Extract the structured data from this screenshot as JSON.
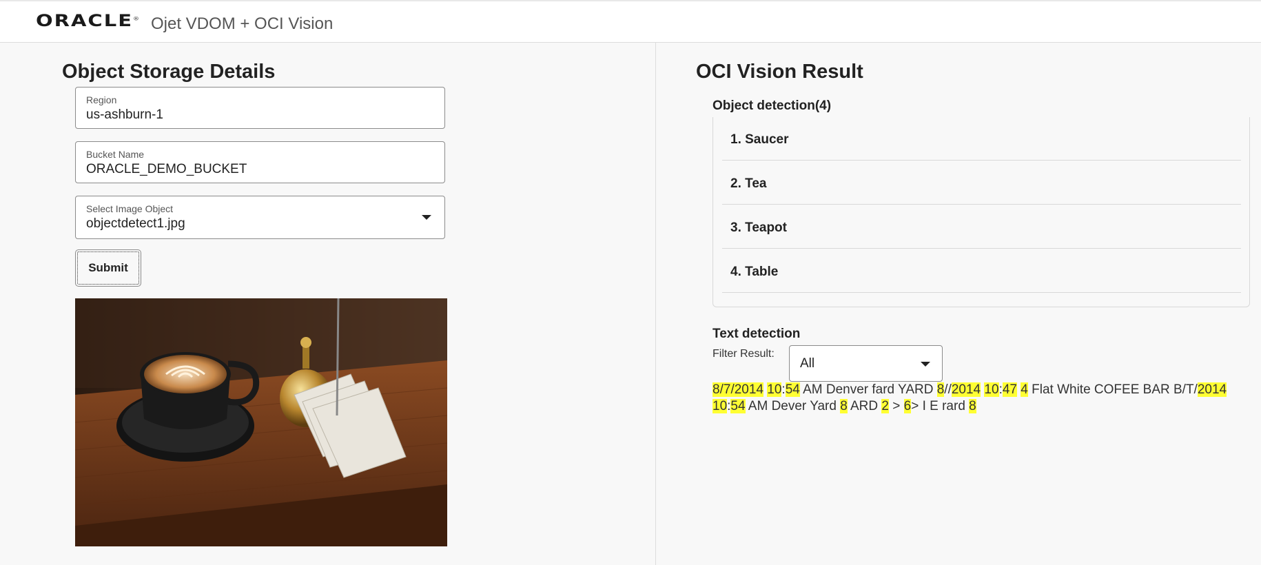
{
  "header": {
    "logo_text": "ORACLE",
    "logo_mark": "®",
    "app_title": "Ojet VDOM + OCI Vision"
  },
  "left": {
    "title": "Object Storage Details",
    "region": {
      "label": "Region",
      "value": "us-ashburn-1"
    },
    "bucket": {
      "label": "Bucket Name",
      "value": "ORACLE_DEMO_BUCKET"
    },
    "image_object": {
      "label": "Select Image Object",
      "value": "objectdetect1.jpg"
    },
    "submit_label": "Submit",
    "photo_alt": "objectdetect1.jpg"
  },
  "right": {
    "title": "OCI Vision Result",
    "object_detection": {
      "heading": "Object detection(4)",
      "items": [
        "1. Saucer",
        "2. Tea",
        "3. Teapot",
        "4. Table"
      ]
    },
    "text_detection": {
      "heading": "Text detection",
      "filter_label": "Filter Result:",
      "filter_value": "All",
      "tokens": [
        {
          "t": "8",
          "hl": true
        },
        {
          "t": "/",
          "hl": true
        },
        {
          "t": "7",
          "hl": true
        },
        {
          "t": "/",
          "hl": true
        },
        {
          "t": "2014",
          "hl": true
        },
        {
          "t": " ",
          "hl": false
        },
        {
          "t": "10",
          "hl": true
        },
        {
          "t": ":",
          "hl": false
        },
        {
          "t": "54",
          "hl": true
        },
        {
          "t": " AM Denver fard YARD ",
          "hl": false
        },
        {
          "t": "8",
          "hl": true
        },
        {
          "t": "//",
          "hl": false
        },
        {
          "t": "2014",
          "hl": true
        },
        {
          "t": " ",
          "hl": false
        },
        {
          "t": "10",
          "hl": true
        },
        {
          "t": ":",
          "hl": false
        },
        {
          "t": "47",
          "hl": true
        },
        {
          "t": " ",
          "hl": false
        },
        {
          "t": "4",
          "hl": true
        },
        {
          "t": " Flat White COFEE BAR B/T/",
          "hl": false
        },
        {
          "t": "2014",
          "hl": true
        },
        {
          "t": " ",
          "hl": false
        },
        {
          "t": "10",
          "hl": true
        },
        {
          "t": ":",
          "hl": false
        },
        {
          "t": "54",
          "hl": true
        },
        {
          "t": " AM Dever Yard ",
          "hl": false
        },
        {
          "t": "8",
          "hl": true
        },
        {
          "t": " ARD ",
          "hl": false
        },
        {
          "t": "2",
          "hl": true
        },
        {
          "t": " > ",
          "hl": false
        },
        {
          "t": "6",
          "hl": true
        },
        {
          "t": "> I E rard ",
          "hl": false
        },
        {
          "t": "8",
          "hl": true
        }
      ]
    }
  },
  "colors": {
    "highlight": "#ffff33",
    "background": "#f8f8f8",
    "header_bg": "#ffffff"
  }
}
